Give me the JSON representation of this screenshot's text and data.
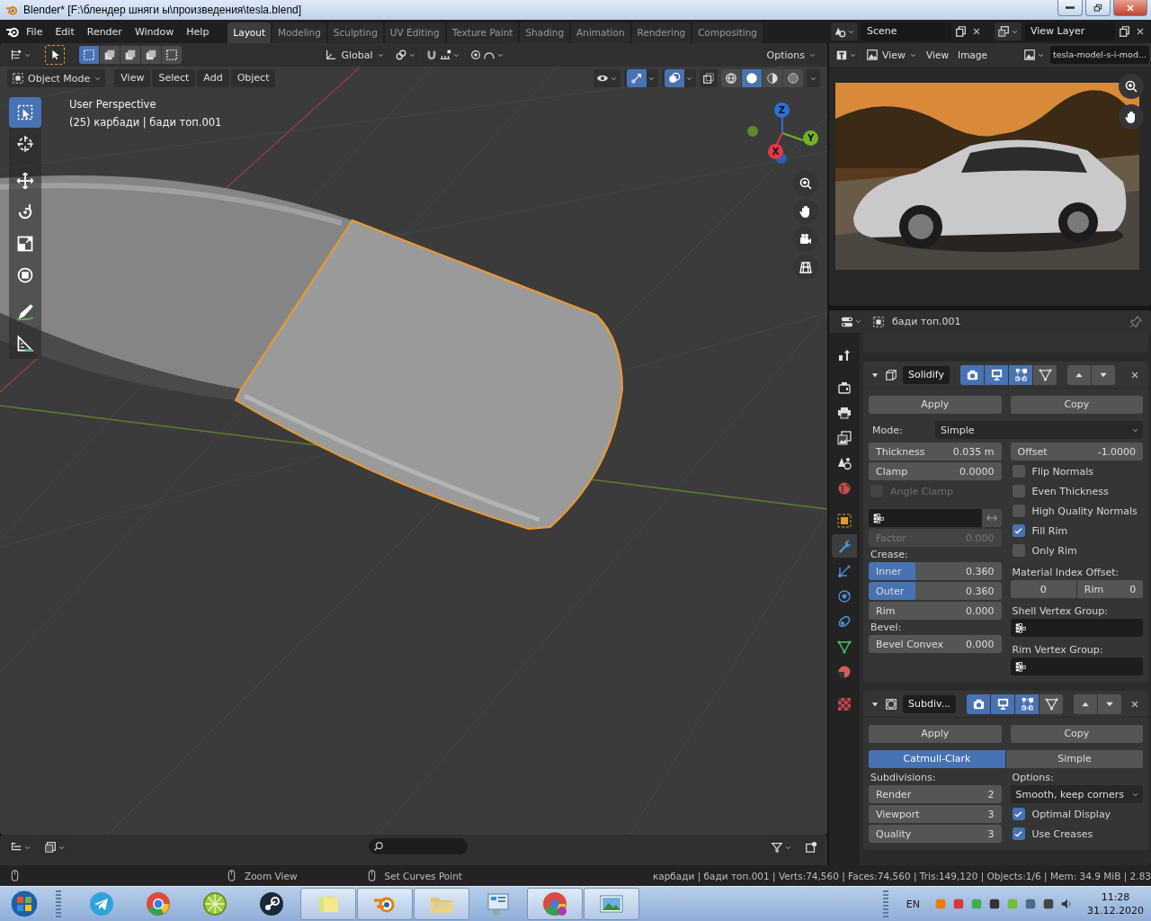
{
  "window": {
    "title": "Blender* [F:\\блендер шняги ы\\произведения\\tesla.blend]"
  },
  "menu": [
    "File",
    "Edit",
    "Render",
    "Window",
    "Help"
  ],
  "workspaces": [
    {
      "label": "Layout",
      "selected": true
    },
    {
      "label": "Modeling",
      "selected": false
    },
    {
      "label": "Sculpting",
      "selected": false
    },
    {
      "label": "UV Editing",
      "selected": false
    },
    {
      "label": "Texture Paint",
      "selected": false
    },
    {
      "label": "Shading",
      "selected": false
    },
    {
      "label": "Animation",
      "selected": false
    },
    {
      "label": "Rendering",
      "selected": false
    },
    {
      "label": "Compositing",
      "selected": false
    }
  ],
  "scene": {
    "name": "Scene"
  },
  "view_layer": {
    "name": "View Layer"
  },
  "viewport": {
    "orientation": "Global",
    "options": "Options",
    "mode": "Object Mode",
    "menus": [
      "View",
      "Select",
      "Add",
      "Object"
    ],
    "select_modes": [
      {
        "selected": true
      },
      {
        "selected": false
      },
      {
        "selected": false
      },
      {
        "selected": false
      },
      {
        "selected": false
      }
    ],
    "shading": [
      {
        "kind": "wireframe",
        "selected": false
      },
      {
        "kind": "solid",
        "selected": true
      },
      {
        "kind": "material",
        "selected": false
      },
      {
        "kind": "rendered",
        "selected": false
      }
    ],
    "info": [
      "User Perspective",
      "(25) карбади | бади топ.001"
    ],
    "tools": [
      {
        "kind": "select",
        "selected": true
      },
      {
        "kind": "cursor",
        "selected": false
      },
      {
        "kind": "move",
        "selected": false
      },
      {
        "kind": "rotate",
        "selected": false
      },
      {
        "kind": "scale",
        "selected": false
      },
      {
        "kind": "transform",
        "selected": false
      },
      {
        "kind": "annotate",
        "selected": false
      },
      {
        "kind": "measure",
        "selected": false
      }
    ],
    "axes": [
      {
        "label": "Z",
        "color": "#2f6fd6"
      },
      {
        "label": "Y",
        "color": "#72b324"
      },
      {
        "label": "X",
        "color": "#e0384a"
      }
    ]
  },
  "image_editor": {
    "view_mode": "View",
    "menus": [
      "View",
      "Image"
    ],
    "image": "tesla-model-s-i-mod...",
    "picture": {
      "kind": "picture"
    }
  },
  "properties": {
    "object": "бади топ.001",
    "tabs": [
      {
        "kind": "tool",
        "selected": false
      },
      {
        "kind": "render",
        "selected": false
      },
      {
        "kind": "output",
        "selected": false
      },
      {
        "kind": "view_layer",
        "selected": false
      },
      {
        "kind": "scene",
        "selected": false
      },
      {
        "kind": "world",
        "selected": false
      },
      {
        "kind": "object",
        "selected": false
      },
      {
        "kind": "modifiers",
        "selected": true
      },
      {
        "kind": "particles",
        "selected": false
      },
      {
        "kind": "physics",
        "selected": false
      },
      {
        "kind": "constraints",
        "selected": false
      },
      {
        "kind": "data",
        "selected": false
      },
      {
        "kind": "material",
        "selected": false
      },
      {
        "kind": "texture",
        "selected": false
      }
    ],
    "modifiers": [
      {
        "kind": "solidify",
        "name": "Solidify",
        "expanded": true,
        "toggles": [
          {
            "kind": "render",
            "on": true
          },
          {
            "kind": "viewport",
            "on": true
          },
          {
            "kind": "editmode",
            "on": true
          },
          {
            "kind": "cage",
            "on": false
          }
        ],
        "actions": [
          "Apply",
          "Copy"
        ],
        "mode": {
          "label": "Mode:",
          "value": "Simple"
        },
        "left": [
          {
            "kind": "field",
            "label": "Thickness",
            "value": "0.035 m",
            "disabled": false
          },
          {
            "kind": "field",
            "label": "Clamp",
            "value": "0.0000",
            "disabled": false
          },
          {
            "kind": "check",
            "label": "Angle Clamp",
            "checked": false,
            "disabled": true
          },
          {
            "kind": "vgroup_invert"
          },
          {
            "kind": "field",
            "label": "Factor",
            "value": "0.000",
            "disabled": true
          },
          {
            "kind": "label",
            "text": "Crease:"
          },
          {
            "kind": "slider",
            "label": "Inner",
            "value": "0.360",
            "level": 0.35
          },
          {
            "kind": "slider",
            "label": "Outer",
            "value": "0.360",
            "level": 0.35
          },
          {
            "kind": "field",
            "label": "Rim",
            "value": "0.000",
            "disabled": false
          },
          {
            "kind": "label",
            "text": "Bevel:"
          },
          {
            "kind": "field",
            "label": "Bevel Convex",
            "value": "0.000",
            "disabled": false
          }
        ],
        "right": [
          {
            "kind": "field",
            "label": "Offset",
            "value": "-1.0000",
            "disabled": false
          },
          {
            "kind": "check",
            "label": "Flip Normals",
            "checked": false,
            "disabled": false
          },
          {
            "kind": "check",
            "label": "Even Thickness",
            "checked": false,
            "disabled": false
          },
          {
            "kind": "check",
            "label": "High Quality Normals",
            "checked": false,
            "disabled": false
          },
          {
            "kind": "check",
            "label": "Fill Rim",
            "checked": true,
            "disabled": false
          },
          {
            "kind": "check",
            "label": "Only Rim",
            "checked": false,
            "disabled": false
          },
          {
            "kind": "label",
            "text": "Material Index Offset:"
          },
          {
            "kind": "pair",
            "fields": [
              {
                "value": "0"
              },
              {
                "label": "Rim",
                "value": "0"
              }
            ]
          },
          {
            "kind": "label",
            "text": "Shell Vertex Group:"
          },
          {
            "kind": "vgroup"
          },
          {
            "kind": "label",
            "text": "Rim Vertex Group:"
          },
          {
            "kind": "vgroup"
          }
        ]
      },
      {
        "kind": "subdivision",
        "name": "Subdiv...",
        "expanded": true,
        "toggles": [
          {
            "kind": "render",
            "on": true
          },
          {
            "kind": "viewport",
            "on": true
          },
          {
            "kind": "editmode",
            "on": true
          },
          {
            "kind": "cage",
            "on": false
          }
        ],
        "actions": [
          "Apply",
          "Copy"
        ],
        "segments": [
          {
            "label": "Catmull-Clark",
            "selected": true
          },
          {
            "label": "Simple",
            "selected": false
          }
        ],
        "left": [
          {
            "kind": "label",
            "text": "Subdivisions:"
          },
          {
            "kind": "field",
            "label": "Render",
            "value": "2",
            "disabled": false
          },
          {
            "kind": "field",
            "label": "Viewport",
            "value": "3",
            "disabled": false
          },
          {
            "kind": "field",
            "label": "Quality",
            "value": "3",
            "disabled": false
          }
        ],
        "right": [
          {
            "kind": "label",
            "text": "Options:"
          },
          {
            "kind": "dropdown",
            "value": "Smooth, keep corners"
          },
          {
            "kind": "check",
            "label": "Optimal Display",
            "checked": true,
            "disabled": false
          },
          {
            "kind": "check",
            "label": "Use Creases",
            "checked": true,
            "disabled": false
          }
        ]
      }
    ]
  },
  "status_bar": {
    "hints": [
      "Zoom View",
      "Set Curves Point"
    ],
    "stats": "карбади | бади топ.001 | Verts:74,560 | Faces:74,560 | Tris:149,120 | Objects:1/6 | Mem: 34.9 MiB | 2.83"
  },
  "taskbar": {
    "apps": [
      {
        "kind": "telegram",
        "running": false
      },
      {
        "kind": "browser",
        "running": false
      },
      {
        "kind": "lime",
        "running": false
      },
      {
        "kind": "steam",
        "running": false
      },
      {
        "kind": "notes",
        "running": true
      },
      {
        "kind": "blender",
        "running": true
      },
      {
        "kind": "explorer",
        "running": true
      },
      {
        "kind": "control",
        "running": false
      },
      {
        "kind": "browser2",
        "running": true
      },
      {
        "kind": "photos",
        "running": true
      }
    ],
    "language": "EN",
    "time": "11:28",
    "date": "31.12.2020"
  }
}
